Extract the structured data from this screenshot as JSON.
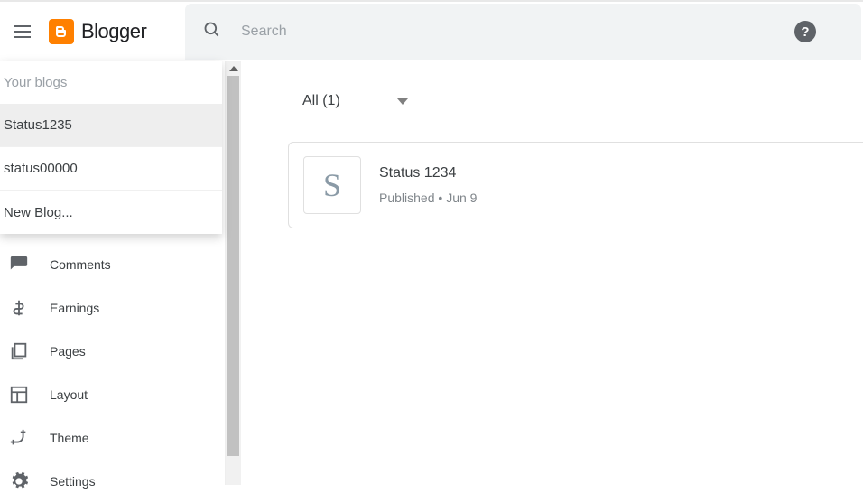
{
  "header": {
    "brand": "Blogger",
    "search_placeholder": "Search",
    "help": "?"
  },
  "dropdown": {
    "header": "Your blogs",
    "items": [
      {
        "label": "Status1235",
        "selected": true
      },
      {
        "label": "status00000",
        "selected": false
      }
    ],
    "new_blog": "New Blog..."
  },
  "sidebar": {
    "items": [
      {
        "icon": "comment",
        "label": "Comments"
      },
      {
        "icon": "dollar",
        "label": "Earnings"
      },
      {
        "icon": "pages",
        "label": "Pages"
      },
      {
        "icon": "layout",
        "label": "Layout"
      },
      {
        "icon": "theme",
        "label": "Theme"
      },
      {
        "icon": "gear",
        "label": "Settings"
      }
    ]
  },
  "filter": {
    "label": "All (1)"
  },
  "post": {
    "thumb_letter": "S",
    "title": "Status 1234",
    "status": "Published",
    "dot": "•",
    "date": "Jun 9"
  }
}
